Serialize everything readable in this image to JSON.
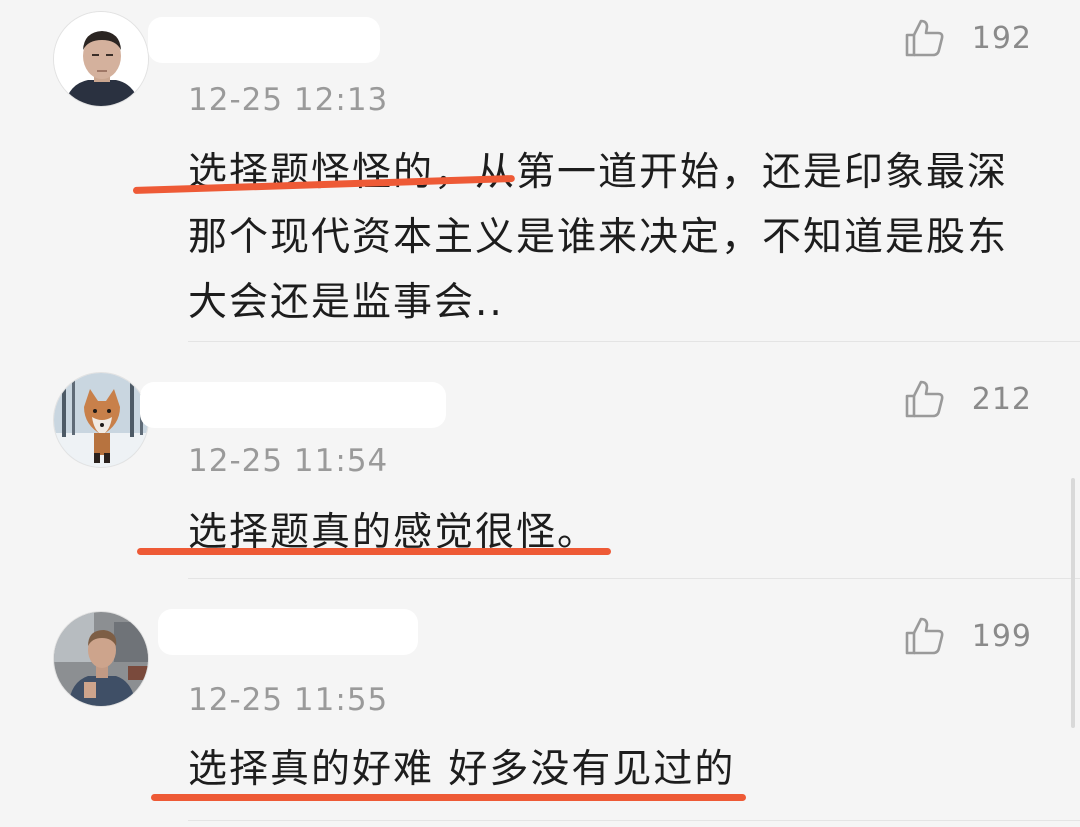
{
  "comments": [
    {
      "avatar_icon": "user-avatar-icon",
      "timestamp": "12-25 12:13",
      "likes": "192",
      "text": "选择题怪怪的，从第一道开始，还是印象最深那个现代资本主义是谁来决定，不知道是股东大会还是监事会.."
    },
    {
      "avatar_icon": "fox-avatar-icon",
      "timestamp": "12-25 11:54",
      "likes": "212",
      "text": "选择题真的感觉很怪。"
    },
    {
      "avatar_icon": "person-photo-avatar-icon",
      "timestamp": "12-25 11:55",
      "likes": "199",
      "text": "选择真的好难 好多没有见过的"
    }
  ],
  "colors": {
    "underline": "#ee5a36",
    "background": "#f5f5f5",
    "text": "#1d1d1d",
    "meta": "#9a9a9a"
  },
  "icons": {
    "like": "thumbs-up-icon"
  }
}
